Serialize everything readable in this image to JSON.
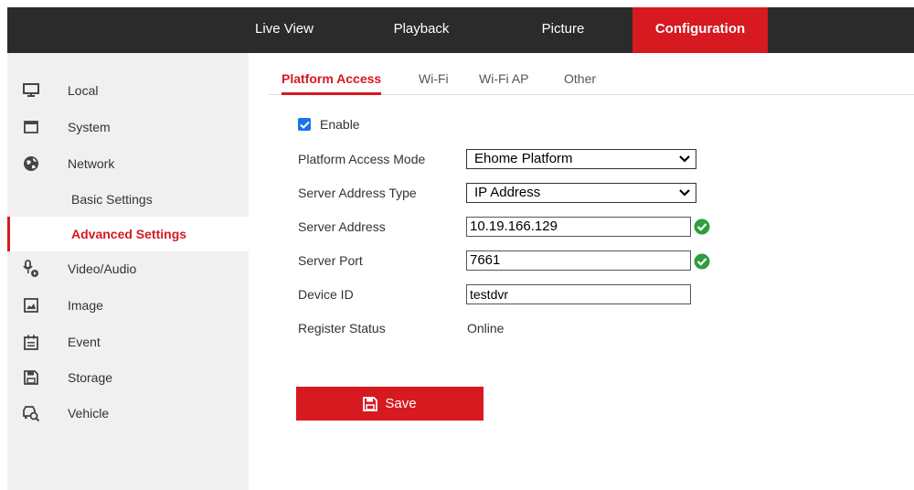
{
  "nav": {
    "items": [
      {
        "label": "Live View"
      },
      {
        "label": "Playback"
      },
      {
        "label": "Picture"
      },
      {
        "label": "Configuration",
        "active": true
      }
    ]
  },
  "sidebar": {
    "items": [
      {
        "label": "Local",
        "icon": "monitor-icon"
      },
      {
        "label": "System",
        "icon": "window-icon"
      },
      {
        "label": "Network",
        "icon": "globe-icon"
      },
      {
        "label": "Basic Settings",
        "sub": true
      },
      {
        "label": "Advanced Settings",
        "sub": true,
        "active": true
      },
      {
        "label": "Video/Audio",
        "icon": "audio-video-icon"
      },
      {
        "label": "Image",
        "icon": "image-icon"
      },
      {
        "label": "Event",
        "icon": "calendar-icon"
      },
      {
        "label": "Storage",
        "icon": "floppy-icon"
      },
      {
        "label": "Vehicle",
        "icon": "vehicle-search-icon"
      }
    ]
  },
  "tabs": [
    {
      "label": "Platform Access",
      "active": true
    },
    {
      "label": "Wi-Fi"
    },
    {
      "label": "Wi-Fi AP"
    },
    {
      "label": "Other"
    }
  ],
  "form": {
    "enable_label": "Enable",
    "enable_checked": true,
    "mode_label": "Platform Access Mode",
    "mode_value": "Ehome Platform",
    "addr_type_label": "Server Address Type",
    "addr_type_value": "IP Address",
    "server_addr_label": "Server Address",
    "server_addr_value": "10.19.166.129",
    "server_port_label": "Server Port",
    "server_port_value": "7661",
    "device_id_label": "Device ID",
    "device_id_value": "testdvr",
    "register_label": "Register Status",
    "register_value": "Online"
  },
  "save_label": "Save",
  "colors": {
    "accent": "#d71920",
    "header_bg": "#2b2b2b",
    "sidebar_bg": "#f0f0f0",
    "ok_green": "#2e9e3e",
    "checkbox_blue": "#1a73e8"
  }
}
